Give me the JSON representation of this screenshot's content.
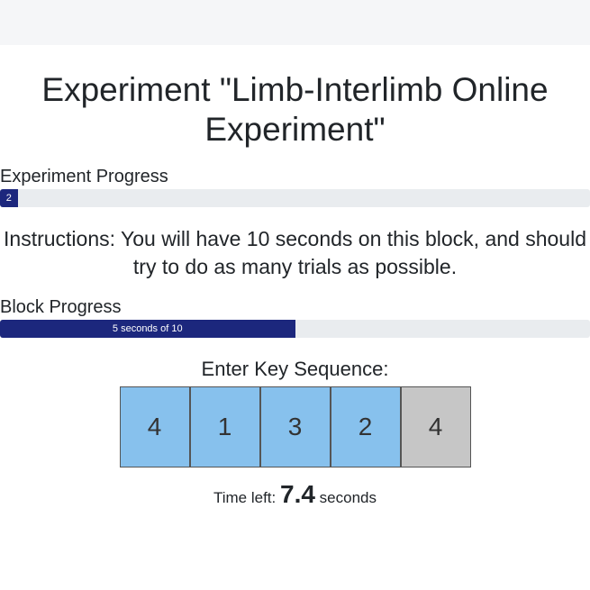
{
  "header": {
    "title_line1": "Experiment \"Limb-Interlimb Online",
    "title_line2": "Experiment\""
  },
  "experiment_progress": {
    "label": "Experiment Progress",
    "text": "2",
    "percent": 3
  },
  "instructions": {
    "line1": "Instructions: You will have 10 seconds on this block, and should",
    "line2": "try to do as many trials as possible."
  },
  "block_progress": {
    "label": "Block Progress",
    "text": "5 seconds of 10",
    "percent": 50
  },
  "sequence": {
    "label": "Enter Key Sequence:",
    "keys": [
      "4",
      "1",
      "3",
      "2",
      "4"
    ],
    "filled_count": 4
  },
  "timer": {
    "prefix": "Time left:",
    "value": "7.4",
    "suffix": "seconds"
  }
}
